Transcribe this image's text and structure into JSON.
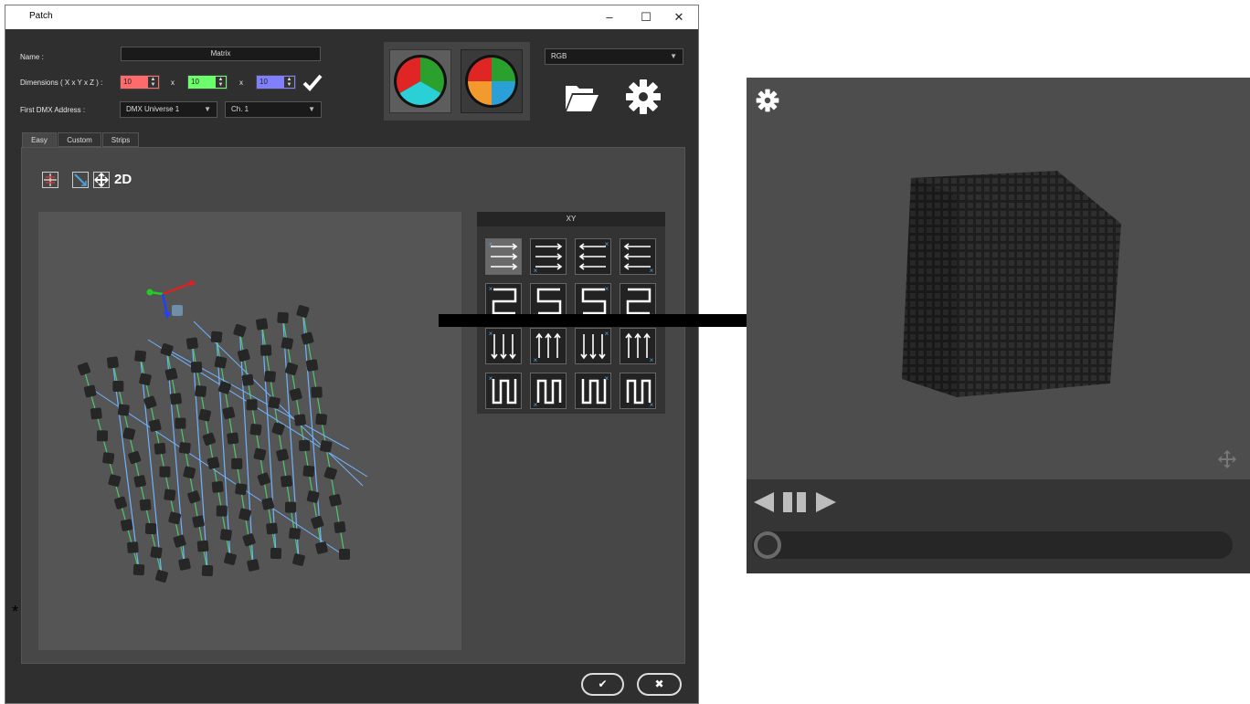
{
  "window": {
    "title": "Patch",
    "controls": [
      "–",
      "☐",
      "✕"
    ]
  },
  "form": {
    "name_label": "Name :",
    "name_value": "Matrix",
    "dims_label": "Dimensions ( X x Y x Z ) :",
    "dim_x": "10",
    "dim_y": "10",
    "dim_z": "10",
    "times": "x",
    "dmx_label": "First DMX Address :",
    "universe": "DMX Universe 1",
    "channel": "Ch. 1"
  },
  "color_mode": "RGB",
  "tabs": [
    "Easy",
    "Custom",
    "Strips"
  ],
  "view_mode_label": "2D",
  "xy_header": "XY",
  "asterisk": "*",
  "colors": {
    "dim_x": "#ff6b6b",
    "dim_y": "#6bff6b",
    "dim_z": "#8080ff",
    "accent_blue": "#4aa3e0",
    "wire_green": "#4cc96a",
    "wire_blue": "#6fb3ff"
  },
  "icons": {
    "confirm": "check-icon",
    "folder": "folder-open-icon",
    "settings": "gear-icon",
    "ok": "check-icon",
    "cancel": "close-icon"
  }
}
